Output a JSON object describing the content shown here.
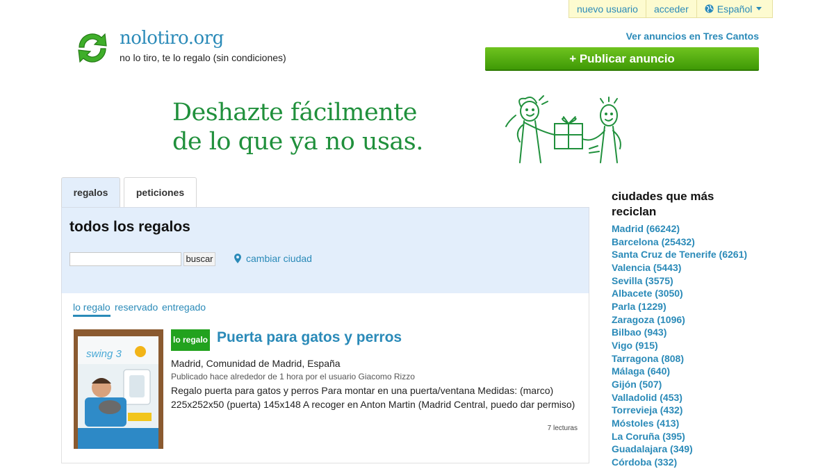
{
  "topmenu": {
    "register": "nuevo usuario",
    "login": "acceder",
    "language": "Español"
  },
  "site": {
    "name": "nolotiro.org",
    "tagline": "no lo tiro, te lo regalo (sin condiciones)"
  },
  "header": {
    "city_link": "Ver anuncios en Tres Cantos",
    "publish_button": "+ Publicar anuncio"
  },
  "hero": {
    "line1": "Deshazte fácilmente",
    "line2": "de lo que ya no usas."
  },
  "tabs": [
    {
      "label": "regalos"
    },
    {
      "label": "peticiones"
    }
  ],
  "panel": {
    "title": "todos los regalos",
    "search_value": "",
    "search_button": "buscar",
    "change_city": "cambiar ciudad"
  },
  "filters": [
    {
      "label": "lo regalo"
    },
    {
      "label": "reservado"
    },
    {
      "label": "entregado"
    }
  ],
  "listing": {
    "badge": "lo regalo",
    "title": "Puerta para gatos y perros",
    "location": "Madrid, Comunidad de Madrid, España",
    "meta": "Publicado hace alrededor de 1 hora por el usuario Giacomo Rizzo",
    "description": "Regalo puerta para gatos y perros Para montar en una puerta/ventana Medidas: (marco) 225x252x50 (puerta) 145x148 A recoger en Anton Martin (Madrid Central, puedo dar permiso)",
    "reads": "7 lecturas",
    "image_box_text": "swing 3"
  },
  "sidebar": {
    "title": "ciudades que más reciclan",
    "cities": [
      "Madrid (66242)",
      "Barcelona (25432)",
      "Santa Cruz de Tenerife (6261)",
      "Valencia (5443)",
      "Sevilla (3575)",
      "Albacete (3050)",
      "Parla (1229)",
      "Zaragoza (1096)",
      "Bilbao (943)",
      "Vigo (915)",
      "Tarragona (808)",
      "Málaga (640)",
      "Gijón (507)",
      "Valladolid (453)",
      "Torrevieja (432)",
      "Móstoles (413)",
      "La Coruña (395)",
      "Guadalajara (349)",
      "Córdoba (332)"
    ]
  },
  "colors": {
    "link": "#2a8ab8",
    "brand_green": "#20903c",
    "button_green": "#4fae0f",
    "panel_bg": "#e3eefb",
    "badge_green": "#22a21e"
  }
}
